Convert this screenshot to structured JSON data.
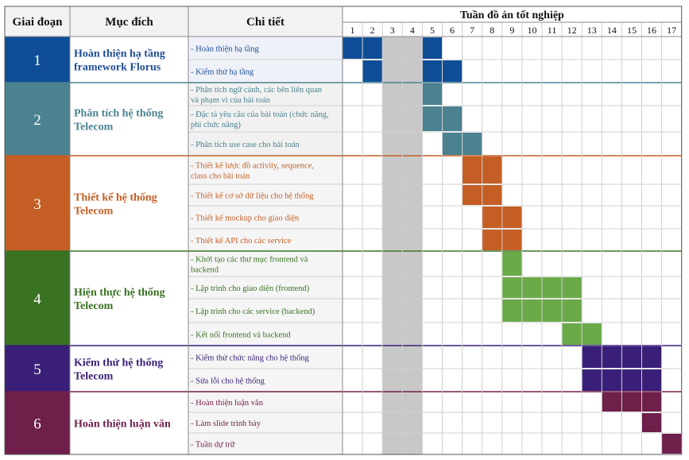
{
  "headers": {
    "phase": "Giai đoạn",
    "purpose": "Mục đích",
    "detail": "Chi tiết",
    "weeks_title": "Tuần đồ án tốt nghiệp"
  },
  "weeks": [
    "1",
    "2",
    "3",
    "4",
    "5",
    "6",
    "7",
    "8",
    "9",
    "10",
    "11",
    "12",
    "13",
    "14",
    "15",
    "16",
    "17"
  ],
  "colors": {
    "header_bg": "#f2f2f2",
    "grid": "#d0d0d0",
    "border": "#555555",
    "holiday_shade": "#c8c8c8"
  },
  "chart_data": {
    "type": "gantt",
    "x_unit": "week",
    "x_range": [
      1,
      17
    ],
    "shaded_weeks": [
      3,
      4
    ],
    "phases": [
      {
        "number": "1",
        "purpose": [
          "Hoàn thiện hạ tầng",
          "framework Florus"
        ],
        "color": "#0f4e96",
        "text_color": "#1f4e96",
        "light_bg": "#eef1f7",
        "tasks": [
          {
            "label": [
              "- Hoàn thiện hạ tầng"
            ],
            "start": 1,
            "end": 2,
            "segments": [
              [
                1,
                2
              ],
              [
                5,
                5
              ]
            ]
          },
          {
            "label": [
              "- Kiểm thử hạ tầng"
            ],
            "start": 2,
            "end": 6,
            "segments": [
              [
                2,
                2
              ],
              [
                5,
                6
              ]
            ]
          }
        ]
      },
      {
        "number": "2",
        "purpose": [
          "Phân tích hệ thống",
          "Telecom"
        ],
        "color": "#4a8290",
        "text_color": "#4a8290",
        "light_bg": "#f1f1f1",
        "tasks": [
          {
            "label": [
              "- Phân tích ngữ cảnh, các bên liên quan",
              "và phạm vi của bài toán"
            ],
            "segments": [
              [
                5,
                5
              ]
            ]
          },
          {
            "label": [
              "- Đặc tả yêu cầu của bài toán (chức năng,",
              "phi chức năng)"
            ],
            "segments": [
              [
                5,
                6
              ]
            ]
          },
          {
            "label": [
              "- Phân tích use case cho bài toán"
            ],
            "segments": [
              [
                6,
                7
              ]
            ]
          }
        ]
      },
      {
        "number": "3",
        "purpose": [
          "Thiết kế hệ thống",
          "Telecom"
        ],
        "color": "#c45e24",
        "text_color": "#c45e24",
        "light_bg": "#f5f5f5",
        "tasks": [
          {
            "label": [
              "- Thiết kế lược đồ activity, sequence,",
              "class cho bài toán"
            ],
            "segments": [
              [
                7,
                8
              ]
            ]
          },
          {
            "label": [
              "- Thiết kế cơ sở dữ liệu cho hệ thống"
            ],
            "segments": [
              [
                7,
                8
              ]
            ]
          },
          {
            "label": [
              "- Thiết kế mockup cho giao diện"
            ],
            "segments": [
              [
                8,
                9
              ]
            ]
          },
          {
            "label": [
              "- Thiết kế API cho các service"
            ],
            "segments": [
              [
                8,
                9
              ]
            ]
          }
        ]
      },
      {
        "number": "4",
        "purpose": [
          "Hiện thực hệ thống",
          "Telecom"
        ],
        "color": "#3a7224",
        "text_color": "#3a7224",
        "bar_color": "#6aaa48",
        "light_bg": "#f5f5f5",
        "tasks": [
          {
            "label": [
              "- Khởi tạo các thư mục frontend và",
              "backend"
            ],
            "segments": [
              [
                9,
                9
              ]
            ]
          },
          {
            "label": [
              "- Lập trình cho giao diện (frontend)"
            ],
            "segments": [
              [
                9,
                12
              ]
            ]
          },
          {
            "label": [
              "- Lập trình cho các service (backend)"
            ],
            "segments": [
              [
                9,
                12
              ]
            ]
          },
          {
            "label": [
              "- Kết nối frontend và backend"
            ],
            "segments": [
              [
                12,
                13
              ]
            ]
          }
        ]
      },
      {
        "number": "5",
        "purpose": [
          "Kiểm thử hệ thống",
          "Telecom"
        ],
        "color": "#3a1f78",
        "text_color": "#3a1f78",
        "light_bg": "#f5f5f5",
        "tasks": [
          {
            "label": [
              "- Kiểm thử chức năng cho hệ thống"
            ],
            "segments": [
              [
                13,
                16
              ]
            ]
          },
          {
            "label": [
              "- Sửa lỗi cho hệ thống"
            ],
            "segments": [
              [
                13,
                16
              ]
            ]
          }
        ]
      },
      {
        "number": "6",
        "purpose": [
          "Hoàn thiện luận văn"
        ],
        "color": "#6e1f4a",
        "text_color": "#6e1f4a",
        "light_bg": "#f5f5f5",
        "tasks": [
          {
            "label": [
              "- Hoàn thiện luận văn"
            ],
            "segments": [
              [
                14,
                16
              ]
            ]
          },
          {
            "label": [
              "- Làm slide trình bày"
            ],
            "segments": [
              [
                16,
                16
              ]
            ]
          },
          {
            "label": [
              "- Tuần dự trữ"
            ],
            "segments": [
              [
                17,
                17
              ]
            ]
          }
        ]
      }
    ]
  }
}
